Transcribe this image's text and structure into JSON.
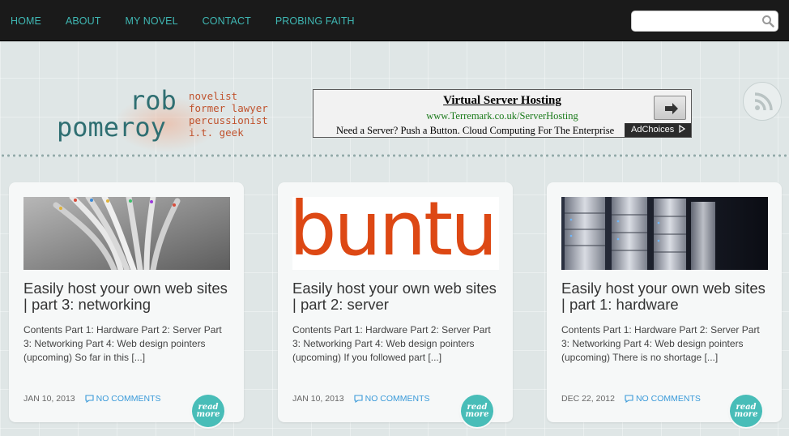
{
  "nav": {
    "items": [
      "HOME",
      "ABOUT",
      "MY NOVEL",
      "CONTACT",
      "PROBING FAITH"
    ]
  },
  "search": {
    "placeholder": ""
  },
  "logo": {
    "name_line1": "rob",
    "name_line2": "pomeroy",
    "tags": [
      "novelist",
      "former lawyer",
      "percussionist",
      "i.t. geek"
    ]
  },
  "ad": {
    "title": "Virtual Server Hosting",
    "url": "www.Terremark.co.uk/ServerHosting",
    "text": "Need a Server? Push a Button. Cloud Computing For The Enterprise",
    "choices_label": "AdChoices"
  },
  "cards": [
    {
      "title": "Easily host your own web sites | part 3: networking",
      "excerpt": "Contents Part 1: Hardware Part 2: Server Part 3: Networking Part 4: Web design pointers (upcoming) So far in this [...]",
      "date": "JAN 10, 2013",
      "comments": "NO COMMENTS",
      "more_line1": "read",
      "more_line2": "more"
    },
    {
      "title": "Easily host your own web sites | part 2: server",
      "excerpt": "Contents Part 1: Hardware Part 2: Server Part 3: Networking Part 4: Web design pointers (upcoming) If you followed part [...]",
      "date": "JAN 10, 2013",
      "comments": "NO COMMENTS",
      "thumb_text": "buntu",
      "more_line1": "read",
      "more_line2": "more"
    },
    {
      "title": "Easily host your own web sites | part 1: hardware",
      "excerpt": "Contents Part 1: Hardware Part 2: Server Part 3: Networking Part 4: Web design pointers (upcoming) There is no shortage [...]",
      "date": "DEC 22, 2012",
      "comments": "NO COMMENTS",
      "more_line1": "read",
      "more_line2": "more"
    }
  ],
  "colors": {
    "nav_bg": "#1a1a1a",
    "nav_link": "#3fb7b3",
    "accent": "#48bdb8",
    "logo_name": "#2f6f72",
    "logo_tags": "#c0532e",
    "ubuntu_orange": "#dd4814"
  }
}
